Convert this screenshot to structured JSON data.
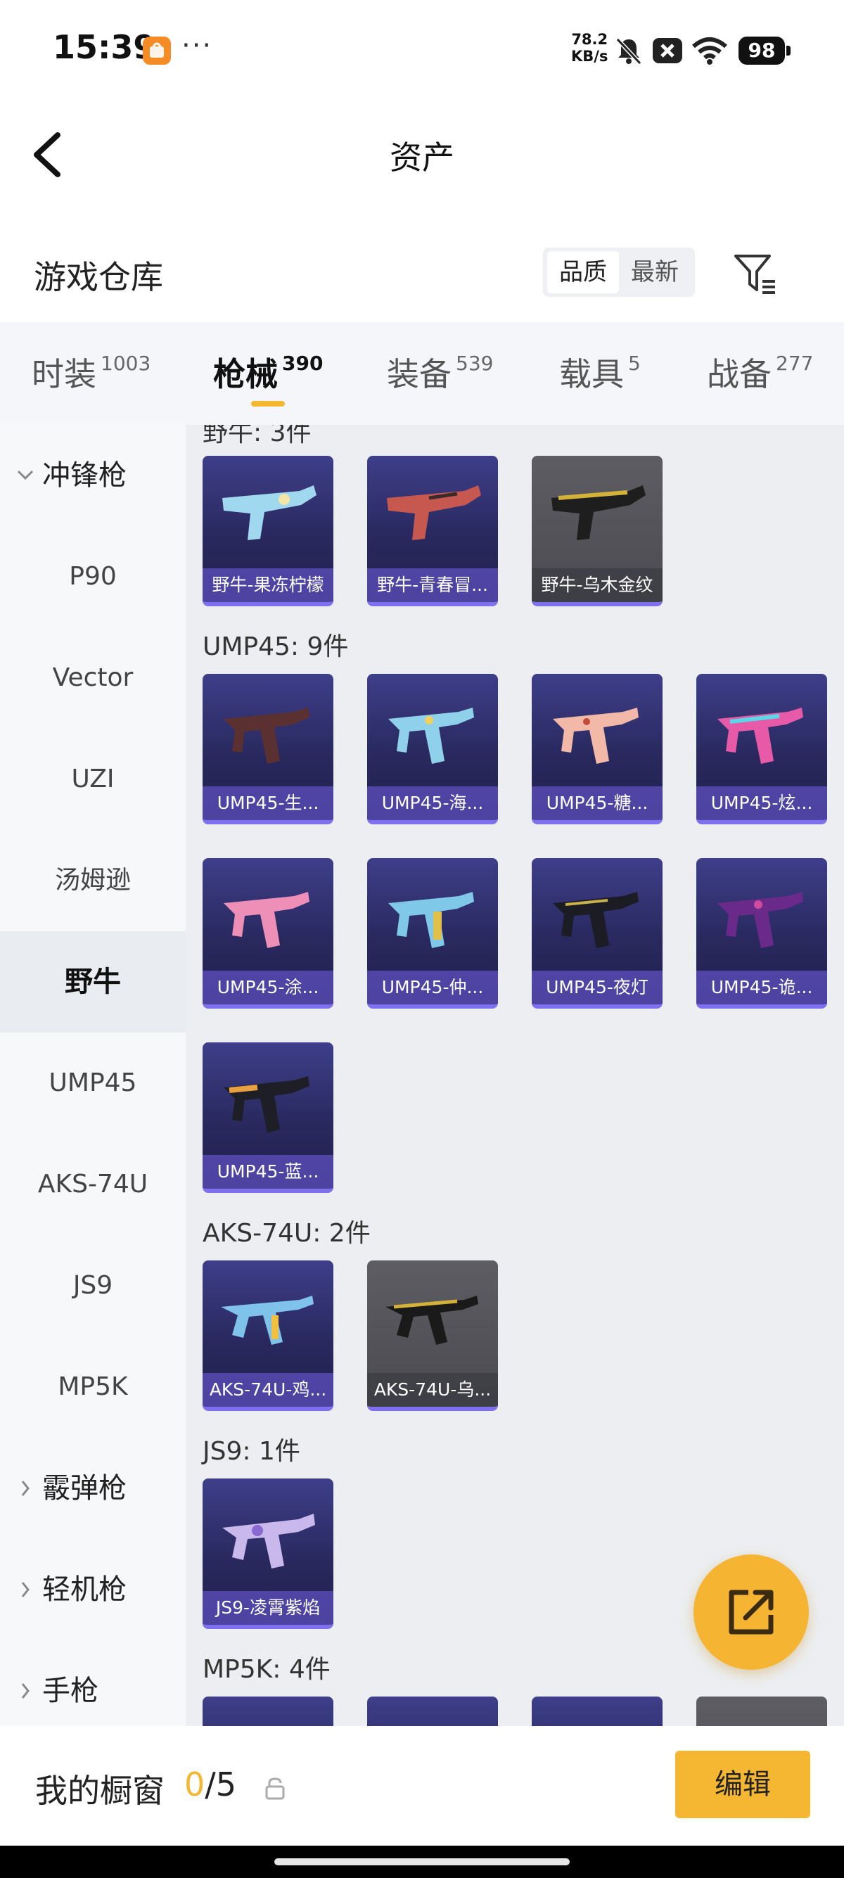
{
  "status_bar": {
    "time": "15:39",
    "app_icon_label": "app",
    "more": "···",
    "net_speed_value": "78.2",
    "net_speed_unit": "KB/s",
    "battery": "98",
    "icons": [
      "mute-bell-icon",
      "close-box-icon",
      "wifi-icon",
      "battery-icon"
    ]
  },
  "header": {
    "title": "资产"
  },
  "section": {
    "title": "游戏仓库",
    "sort_options": [
      "品质",
      "最新"
    ],
    "sort_selected": "品质"
  },
  "tabs": [
    {
      "label": "时装",
      "count": "1003"
    },
    {
      "label": "枪械",
      "count": "390",
      "active": true
    },
    {
      "label": "装备",
      "count": "539"
    },
    {
      "label": "载具",
      "count": "5"
    },
    {
      "label": "战备",
      "count": "277"
    }
  ],
  "sidebar": {
    "group_open": "冲锋枪",
    "items": [
      "P90",
      "Vector",
      "UZI",
      "汤姆逊",
      "野牛",
      "UMP45",
      "AKS-74U",
      "JS9",
      "MP5K"
    ],
    "active_item": "野牛",
    "groups_closed": [
      "霰弹枪",
      "轻机枪",
      "手枪"
    ]
  },
  "content": {
    "partial_label": "野牛: 3件",
    "groups": [
      {
        "label": "UMP45: 9件",
        "items": [
          "UMP45-生...",
          "UMP45-海...",
          "UMP45-糖...",
          "UMP45-炫...",
          "UMP45-涂...",
          "UMP45-仲...",
          "UMP45-夜灯",
          "UMP45-诡...",
          "UMP45-蓝..."
        ]
      },
      {
        "label": "AKS-74U: 2件",
        "items": [
          "AKS-74U-鸡...",
          "AKS-74U-乌..."
        ]
      },
      {
        "label": "JS9: 1件",
        "items": [
          "JS9-凌霄紫焰"
        ]
      },
      {
        "label": "MP5K: 4件",
        "items": []
      }
    ],
    "bison_items": [
      "野牛-果冻柠檬",
      "野牛-青春冒...",
      "野牛-乌木金纹"
    ]
  },
  "bottom_bar": {
    "label": "我的橱窗",
    "used": "0",
    "total": "/5",
    "edit_label": "编辑"
  },
  "colors": {
    "accent": "#f5b731",
    "card_purple": "#29295f",
    "card_gray": "#4a4a50"
  }
}
